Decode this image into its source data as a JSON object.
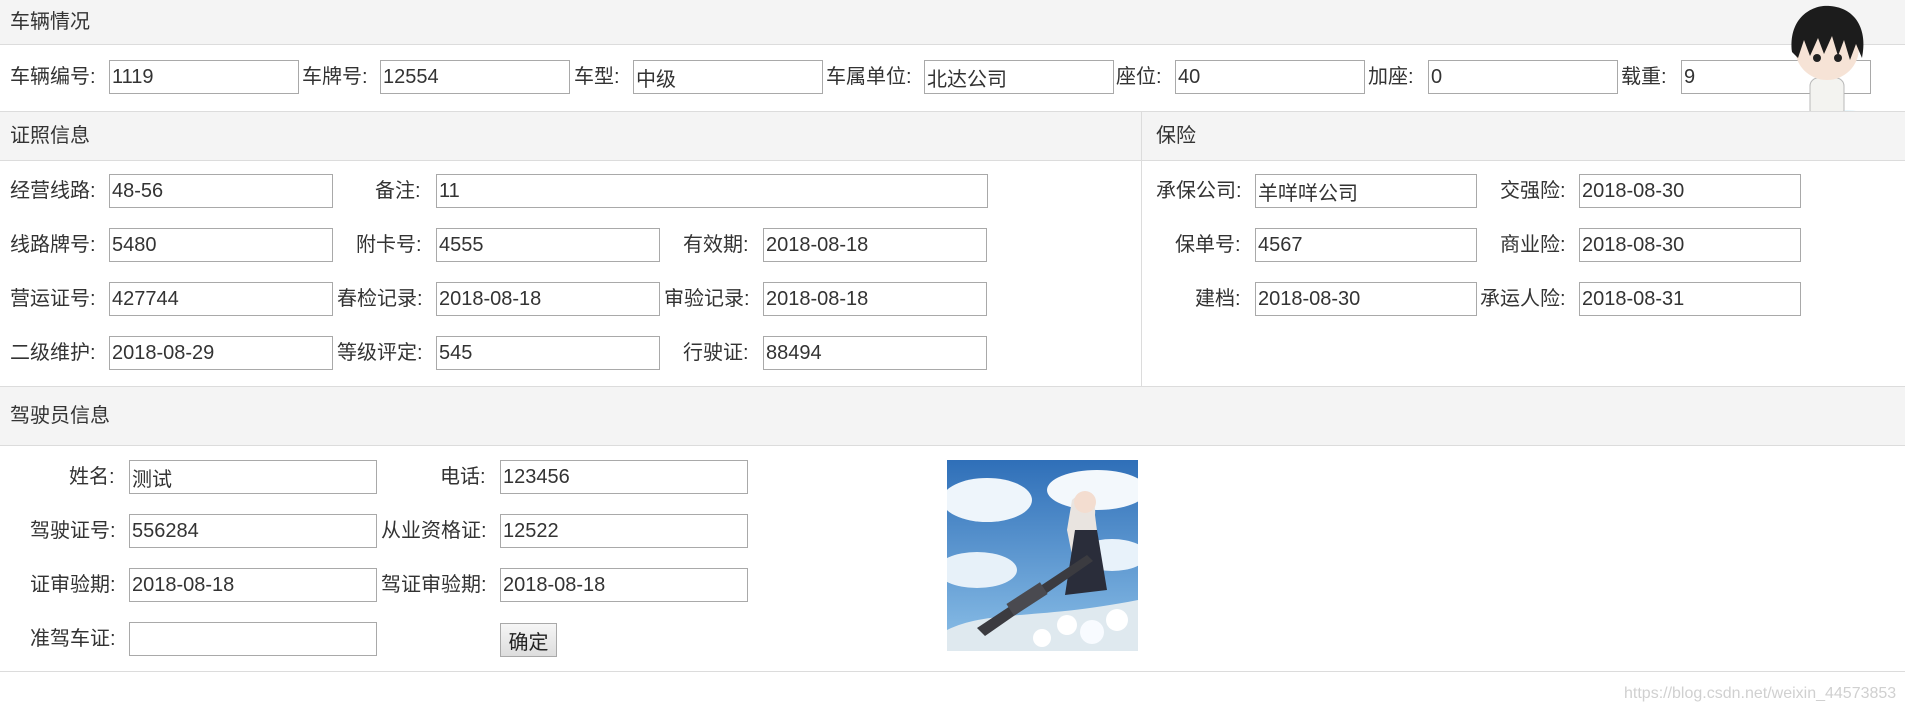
{
  "vehicle": {
    "title": "车辆情况",
    "fields": [
      {
        "label": "车辆编号:",
        "value": "1119"
      },
      {
        "label": "车牌号:",
        "value": "12554"
      },
      {
        "label": "车型:",
        "value": "中级"
      },
      {
        "label": "车属单位:",
        "value": "北达公司"
      },
      {
        "label": "座位:",
        "value": "40"
      },
      {
        "label": "加座:",
        "value": "0"
      },
      {
        "label": "载重:",
        "value": "9"
      }
    ]
  },
  "license": {
    "title": "证照信息",
    "fields": [
      {
        "label": "经营线路:",
        "value": "48-56"
      },
      {
        "label": "备注:",
        "value": "11"
      },
      {
        "label": "线路牌号:",
        "value": "5480"
      },
      {
        "label": "附卡号:",
        "value": "4555"
      },
      {
        "label": "有效期:",
        "value": "2018-08-18"
      },
      {
        "label": "营运证号:",
        "value": "427744"
      },
      {
        "label": "春检记录:",
        "value": "2018-08-18"
      },
      {
        "label": "审验记录:",
        "value": "2018-08-18"
      },
      {
        "label": "二级维护:",
        "value": "2018-08-29"
      },
      {
        "label": "等级评定:",
        "value": "545"
      },
      {
        "label": "行驶证:",
        "value": "88494"
      }
    ]
  },
  "insurance": {
    "title": "保险",
    "fields": [
      {
        "label": "承保公司:",
        "value": "羊咩咩公司"
      },
      {
        "label": "交强险:",
        "value": "2018-08-30"
      },
      {
        "label": "保单号:",
        "value": "4567"
      },
      {
        "label": "商业险:",
        "value": "2018-08-30"
      },
      {
        "label": "建档:",
        "value": "2018-08-30"
      },
      {
        "label": "承运人险:",
        "value": "2018-08-31"
      }
    ]
  },
  "driver": {
    "title": "驾驶员信息",
    "fields": [
      {
        "label": "姓名:",
        "value": "测试"
      },
      {
        "label": "电话:",
        "value": "123456"
      },
      {
        "label": "驾驶证号:",
        "value": "556284"
      },
      {
        "label": "从业资格证:",
        "value": "12522"
      },
      {
        "label": "证审验期:",
        "value": "2018-08-18"
      },
      {
        "label": "驾证审验期:",
        "value": "2018-08-18"
      },
      {
        "label": "准驾车证:",
        "value": ""
      }
    ],
    "confirm_label": "确定",
    "photo_icon": "driver-photo-anime-illustration"
  },
  "watermark": "https://blog.csdn.net/weixin_44573853",
  "mascot_icon": "chibi-character-on-cloud-icon",
  "colors": {
    "header_bg": "#f4f4f4",
    "border": "#dcdcdc",
    "input_border": "#a9a9a9",
    "sky": "#3f86c9"
  }
}
